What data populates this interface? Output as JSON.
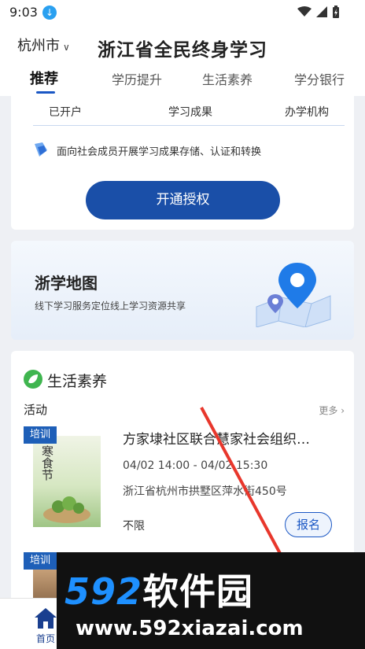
{
  "status_bar": {
    "time": "9:03"
  },
  "header": {
    "city": "杭州市",
    "title": "浙江省全民终身学习",
    "tabs": [
      {
        "label": "推荐",
        "active": true
      },
      {
        "label": "学历提升"
      },
      {
        "label": "生活素养"
      },
      {
        "label": "学分银行"
      }
    ]
  },
  "auth_card": {
    "stats": [
      "已开户",
      "学习成果",
      "办学机构"
    ],
    "feature_text": "面向社会成员开展学习成果存储、认证和转换",
    "button_label": "开通授权"
  },
  "map_card": {
    "title": "浙学地图",
    "subtitle": "线下学习服务定位线上学习资源共享"
  },
  "life_section": {
    "title": "生活素养",
    "activity_label": "活动",
    "more_label": "更多",
    "events": [
      {
        "tag": "培训",
        "thumb_text": "寒食节",
        "title": "方家埭社区联合慧家社会组织…",
        "time": "04/02 14:00 - 04/02 15:30",
        "address": "浙江省杭州市拱墅区萍水街450号",
        "limit": "不限",
        "button_label": "报名"
      },
      {
        "tag": "培训"
      }
    ]
  },
  "bottom_nav": {
    "home_label": "首页"
  },
  "watermark": {
    "brand_number": "592",
    "brand_text": "软件园",
    "url": "www.592xiazai.com"
  },
  "colors": {
    "primary": "#1a4fa8",
    "accent": "#1a57c4",
    "tag": "#1e5fb8",
    "watermark_blue": "#1e90ff"
  }
}
